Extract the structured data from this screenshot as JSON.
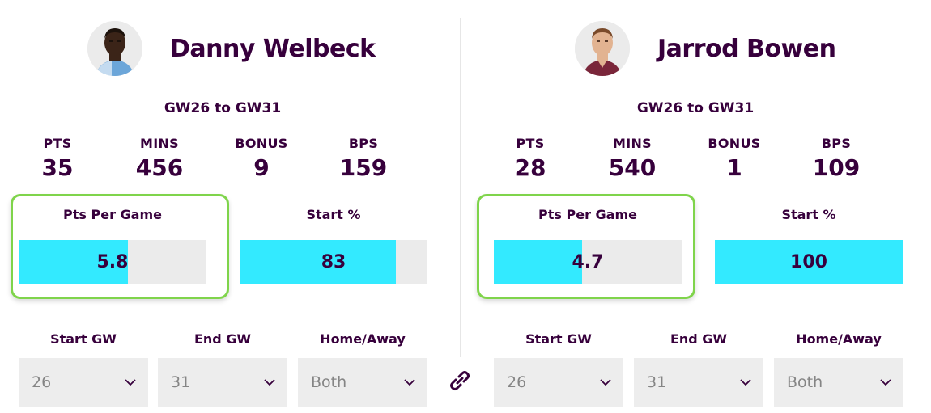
{
  "players": [
    {
      "name": "Danny Welbeck",
      "gw_range": "GW26 to GW31",
      "stats": [
        {
          "label": "PTS",
          "value": "35"
        },
        {
          "label": "MINS",
          "value": "456"
        },
        {
          "label": "BONUS",
          "value": "9"
        },
        {
          "label": "BPS",
          "value": "159"
        }
      ],
      "pts_per_game": {
        "label": "Pts Per Game",
        "value": "5.8",
        "fill_fraction": 0.58
      },
      "start_pct": {
        "label": "Start %",
        "value": "83",
        "fill_fraction": 0.83
      },
      "filters": [
        {
          "label": "Start GW",
          "value": "26"
        },
        {
          "label": "End GW",
          "value": "31"
        },
        {
          "label": "Home/Away",
          "value": "Both"
        }
      ],
      "avatar": {
        "skin": "#3b2418",
        "shirt": "#6ca6d9",
        "hair": "#1c120c"
      }
    },
    {
      "name": "Jarrod Bowen",
      "gw_range": "GW26 to GW31",
      "stats": [
        {
          "label": "PTS",
          "value": "28"
        },
        {
          "label": "MINS",
          "value": "540"
        },
        {
          "label": "BONUS",
          "value": "1"
        },
        {
          "label": "BPS",
          "value": "109"
        }
      ],
      "pts_per_game": {
        "label": "Pts Per Game",
        "value": "4.7",
        "fill_fraction": 0.47
      },
      "start_pct": {
        "label": "Start %",
        "value": "100",
        "fill_fraction": 1.0
      },
      "filters": [
        {
          "label": "Start GW",
          "value": "26"
        },
        {
          "label": "End GW",
          "value": "31"
        },
        {
          "label": "Home/Away",
          "value": "Both"
        }
      ],
      "avatar": {
        "skin": "#e2b391",
        "shirt": "#7a263a",
        "hair": "#7a4a2a"
      }
    }
  ],
  "colors": {
    "text": "#37003c",
    "bar_fill": "#33eaff",
    "bar_track": "#ebebeb",
    "highlight": "#7fd44b",
    "select_bg": "#ededed",
    "select_text": "#858585"
  },
  "icons": {
    "link": "link-icon",
    "chevron": "chevron-down-icon"
  }
}
